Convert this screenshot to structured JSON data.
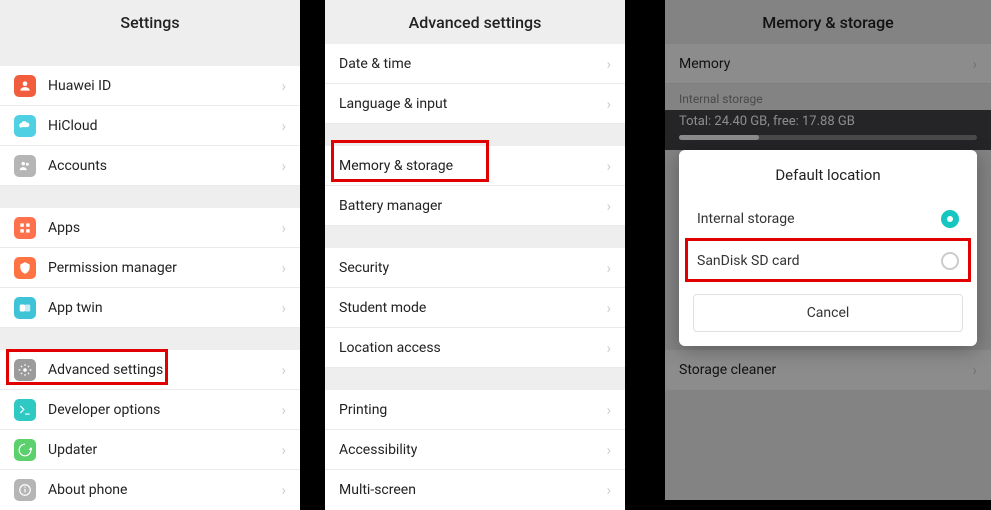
{
  "screen1": {
    "title": "Settings",
    "groups": [
      [
        {
          "label": "Huawei ID",
          "icon": "huawei-id-icon",
          "color": "#f25d3e"
        },
        {
          "label": "HiCloud",
          "icon": "hicloud-icon",
          "color": "#4fd0e3"
        },
        {
          "label": "Accounts",
          "icon": "accounts-icon",
          "color": "#b5b5b5"
        }
      ],
      [
        {
          "label": "Apps",
          "icon": "apps-icon",
          "color": "#ff704d"
        },
        {
          "label": "Permission manager",
          "icon": "permission-icon",
          "color": "#ff7242"
        },
        {
          "label": "App twin",
          "icon": "app-twin-icon",
          "color": "#3fc3d6"
        }
      ],
      [
        {
          "label": "Advanced settings",
          "icon": "advanced-settings-icon",
          "color": "#9b9b9b",
          "highlight": true
        },
        {
          "label": "Developer options",
          "icon": "developer-icon",
          "color": "#2fc9c4"
        },
        {
          "label": "Updater",
          "icon": "updater-icon",
          "color": "#5cd06c"
        },
        {
          "label": "About phone",
          "icon": "about-icon",
          "color": "#b5b5b5"
        }
      ]
    ]
  },
  "screen2": {
    "title": "Advanced settings",
    "groups": [
      [
        {
          "label": "Date & time"
        },
        {
          "label": "Language & input"
        }
      ],
      [
        {
          "label": "Memory & storage",
          "highlight": true
        },
        {
          "label": "Battery manager"
        }
      ],
      [
        {
          "label": "Security"
        },
        {
          "label": "Student mode"
        },
        {
          "label": "Location access"
        }
      ],
      [
        {
          "label": "Printing"
        },
        {
          "label": "Accessibility"
        },
        {
          "label": "Multi-screen"
        }
      ]
    ]
  },
  "screen3": {
    "title": "Memory & storage",
    "memory_label": "Memory",
    "internal_storage_header": "Internal storage",
    "storage_summary": "Total: 24.40 GB, free: 17.88 GB",
    "storage_cleaner": "Storage cleaner",
    "dialog": {
      "title": "Default location",
      "option1": "Internal storage",
      "option2": "SanDisk SD card",
      "cancel": "Cancel"
    }
  }
}
